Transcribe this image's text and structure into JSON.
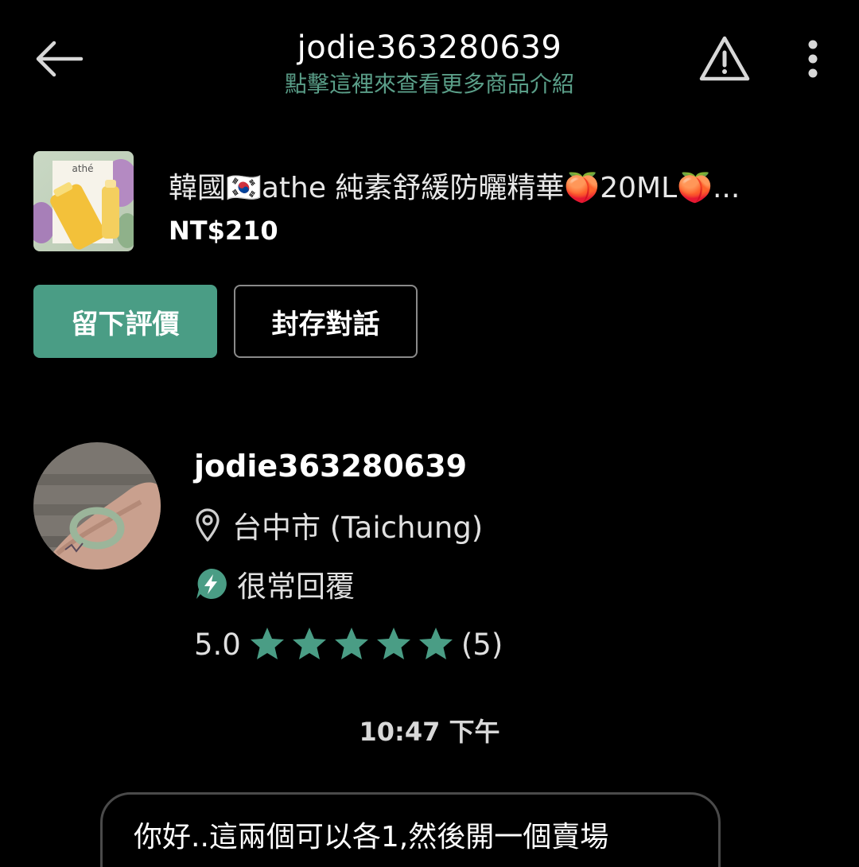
{
  "header": {
    "title": "jodie363280639",
    "subtitle": "點擊這裡來查看更多商品介紹",
    "back_icon": "arrow-left-icon",
    "report_icon": "warning-triangle-icon",
    "more_icon": "more-vertical-icon"
  },
  "product": {
    "title": "韓國🇰🇷athe 純素舒緩防曬精華🍑20ML🍑...",
    "price": "NT$210",
    "thumb_brand_text": "athé"
  },
  "actions": {
    "review_label": "留下評價",
    "archive_label": "封存對話"
  },
  "seller": {
    "name": "jodie363280639",
    "location": "台中市 (Taichung)",
    "response": "很常回覆",
    "rating_value": "5.0",
    "rating_count": "(5)",
    "stars": 5
  },
  "chat": {
    "timestamp": "10:47 下午",
    "message": "你好..這兩個可以各1,然後開一個賣場"
  },
  "colors": {
    "accent": "#4a9d85",
    "subtitle": "#5a9e88",
    "background": "#000000"
  }
}
